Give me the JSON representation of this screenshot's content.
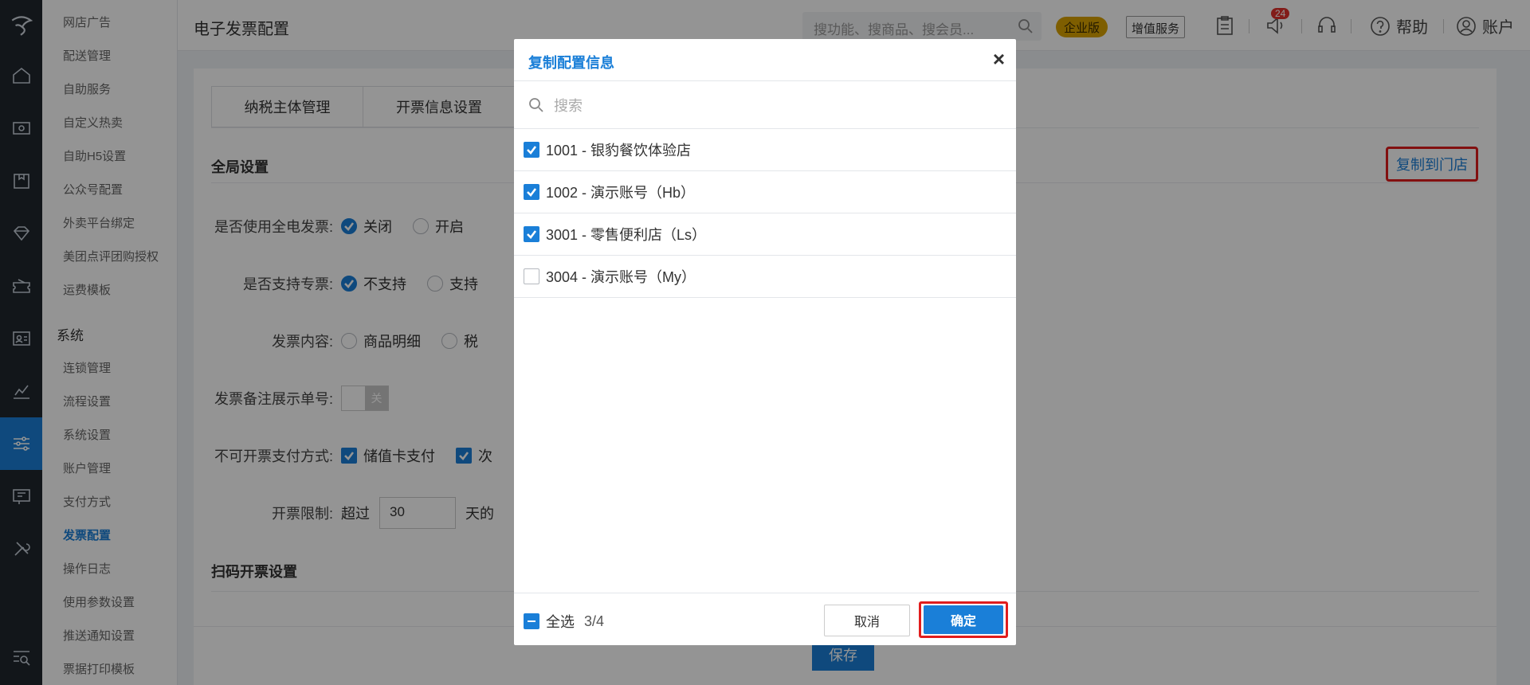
{
  "rail": {
    "icons": [
      "logo-icon",
      "home-icon",
      "cashier-icon",
      "package-icon",
      "diamond-icon",
      "coupon-icon",
      "member-card-icon",
      "chart-icon",
      "settings-sliders-icon",
      "ticket-icon",
      "tools-icon",
      "search-list-icon"
    ]
  },
  "submenu": {
    "items_top": [
      "网店广告",
      "配送管理",
      "自助服务",
      "自定义热卖",
      "自助H5设置",
      "公众号配置",
      "外卖平台绑定",
      "美团点评团购授权",
      "运费模板"
    ],
    "group": "系统",
    "items_sys": [
      "连锁管理",
      "流程设置",
      "系统设置",
      "账户管理",
      "支付方式",
      "发票配置",
      "操作日志",
      "使用参数设置",
      "推送通知设置",
      "票据打印模板"
    ],
    "active": "发票配置"
  },
  "header": {
    "page_title": "电子发票配置",
    "search_placeholder": "搜功能、搜商品、搜会员...",
    "edition": "企业版",
    "value_added": "增值服务",
    "notif_count": "24",
    "help": "帮助",
    "account": "账户"
  },
  "main": {
    "tabs": [
      "纳税主体管理",
      "开票信息设置"
    ],
    "section_global": "全局设置",
    "copy_to_store": "复制到门店",
    "rows": {
      "full_elec_label": "是否使用全电发票:",
      "full_elec_opts": [
        "关闭",
        "开启"
      ],
      "special_label": "是否支持专票:",
      "special_opts": [
        "不支持",
        "支持"
      ],
      "content_label": "发票内容:",
      "content_opts": [
        "商品明细",
        "税"
      ],
      "remark_label": "发票备注展示单号:",
      "remark_toggle": "关",
      "nopay_label": "不可开票支付方式:",
      "nopay_opts": [
        "储值卡支付",
        "次"
      ],
      "limit_label": "开票限制:",
      "limit_prefix": "超过",
      "limit_value": "30",
      "limit_suffix": "天的"
    },
    "section_scan": "扫码开票设置",
    "save": "保存"
  },
  "modal": {
    "title": "复制配置信息",
    "close": "×",
    "search_placeholder": "搜索",
    "items": [
      {
        "label": "1001 - 银豹餐饮体验店",
        "checked": true
      },
      {
        "label": "1002 - 演示账号（Hb）",
        "checked": true
      },
      {
        "label": "3001 - 零售便利店（Ls）",
        "checked": true
      },
      {
        "label": "3004 - 演示账号（My）",
        "checked": false
      }
    ],
    "select_all": "全选",
    "count": "3/4",
    "cancel": "取消",
    "ok": "确定"
  }
}
